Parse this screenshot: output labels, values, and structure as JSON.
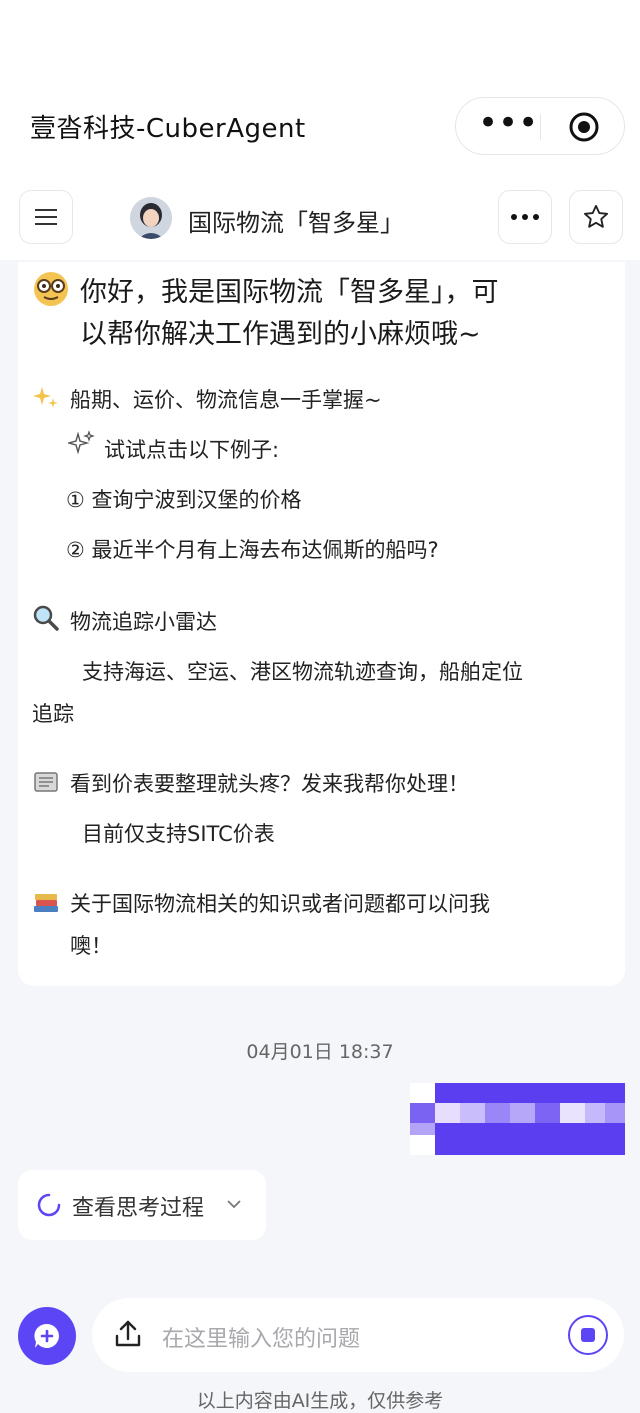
{
  "app": {
    "title": "壹沓科技-CuberAgent",
    "more_icon": "more-horizontal-icon",
    "close_icon": "target-circle-icon"
  },
  "nav": {
    "agent_name": "国际物流「智多星」",
    "menu_icon": "hamburger-icon",
    "more_icon": "ellipsis-icon",
    "star_icon": "star-outline-icon"
  },
  "welcome": {
    "greeting_line1": "你好，我是国际物流「智多星」，可",
    "greeting_line2": "以帮你解决工作遇到的小麻烦哦~",
    "s1_title": "船期、运价、物流信息一手掌握~",
    "s1_hint": "试试点击以下例子:",
    "s1_ex1": "① 查询宁波到汉堡的价格",
    "s1_ex2": "② 最近半个月有上海去布达佩斯的船吗?",
    "s2_title": "物流追踪小雷达",
    "s2_desc_line1": "支持海运、空运、港区物流轨迹查询，船舶定位",
    "s2_desc_line2": "追踪",
    "s3_title": "看到价表要整理就头疼？发来我帮你处理！",
    "s3_desc": "目前仅支持SITC价表",
    "s4_line1": "关于国际物流相关的知识或者问题都可以问我",
    "s4_line2": "噢！"
  },
  "chat": {
    "timestamp": "04月01日  18:37",
    "think_label": "查看思考过程"
  },
  "input": {
    "placeholder": "在这里输入您的问题"
  },
  "footer": {
    "disclaimer": "以上内容由AI生成，仅供参考"
  },
  "colors": {
    "accent": "#5b45f4",
    "background": "#f4f6fa"
  }
}
